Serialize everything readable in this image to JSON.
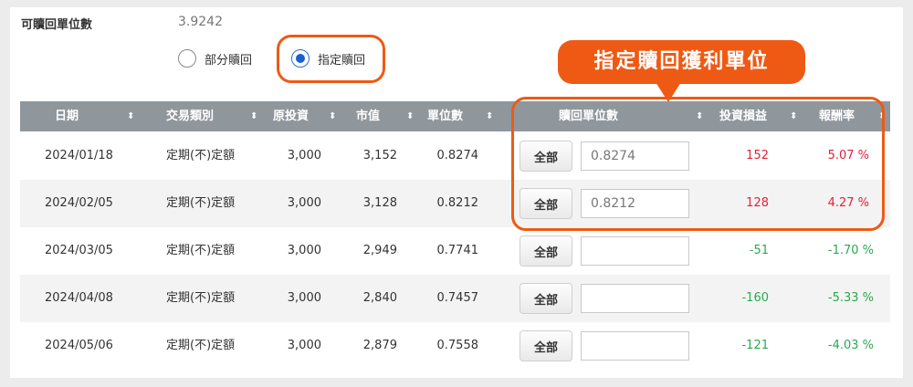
{
  "available_units": {
    "label": "可贖回單位數",
    "value": "3.9242"
  },
  "redeem_mode": {
    "options": [
      {
        "label": "部分贖回",
        "checked": false
      },
      {
        "label": "指定贖回",
        "checked": true
      }
    ]
  },
  "callout": {
    "text": "指定贖回獲利單位"
  },
  "colors": {
    "accent": "#ee5a14",
    "header": "#8f969c",
    "gain": "#e0213b",
    "loss": "#2aa84f",
    "radio": "#1b5fd1"
  },
  "table": {
    "headers": [
      "日期",
      "交易類別",
      "原投資",
      "市值",
      "單位數",
      "贖回單位數",
      "投資損益",
      "報酬率"
    ],
    "sort_icon": "⬍",
    "all_button": "全部",
    "rows": [
      {
        "date": "2024/01/18",
        "type": "定期(不)定額",
        "invest": "3,000",
        "market": "3,152",
        "units": "0.8274",
        "redeem": "0.8274",
        "pl": "152",
        "ret": "5.07 %",
        "sign": "pos"
      },
      {
        "date": "2024/02/05",
        "type": "定期(不)定額",
        "invest": "3,000",
        "market": "3,128",
        "units": "0.8212",
        "redeem": "0.8212",
        "pl": "128",
        "ret": "4.27 %",
        "sign": "pos"
      },
      {
        "date": "2024/03/05",
        "type": "定期(不)定額",
        "invest": "3,000",
        "market": "2,949",
        "units": "0.7741",
        "redeem": "",
        "pl": "-51",
        "ret": "-1.70 %",
        "sign": "neg"
      },
      {
        "date": "2024/04/08",
        "type": "定期(不)定額",
        "invest": "3,000",
        "market": "2,840",
        "units": "0.7457",
        "redeem": "",
        "pl": "-160",
        "ret": "-5.33 %",
        "sign": "neg"
      },
      {
        "date": "2024/05/06",
        "type": "定期(不)定額",
        "invest": "3,000",
        "market": "2,879",
        "units": "0.7558",
        "redeem": "",
        "pl": "-121",
        "ret": "-4.03 %",
        "sign": "neg"
      }
    ]
  }
}
